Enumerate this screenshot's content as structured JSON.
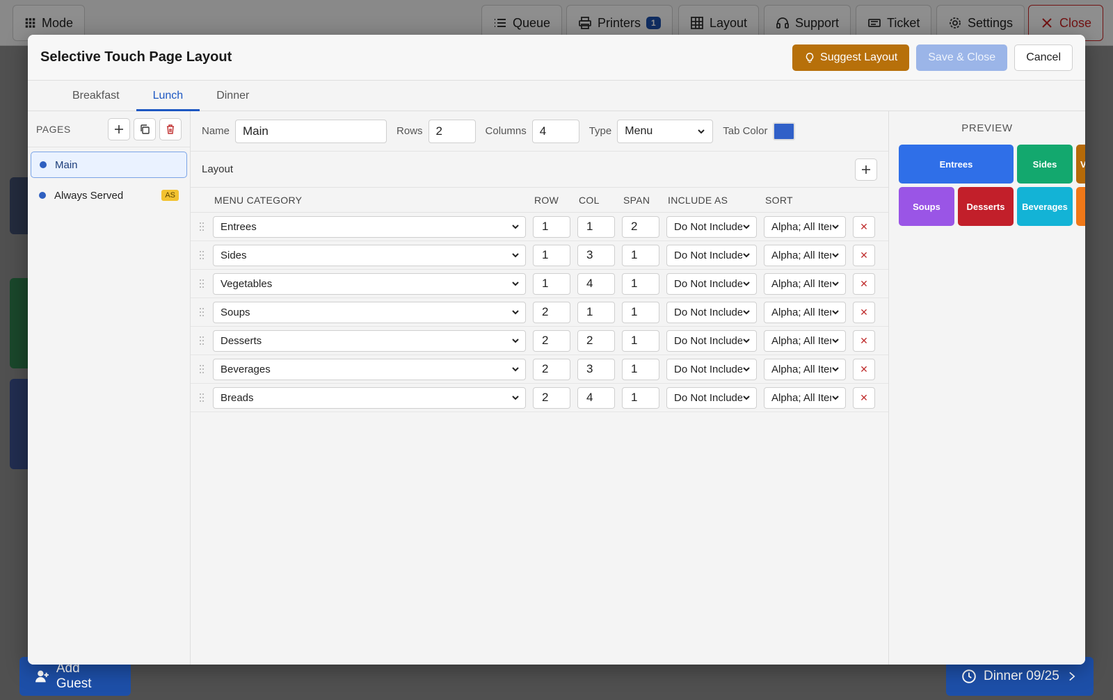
{
  "background": {
    "mode_label": "Mode",
    "toolbar": [
      {
        "label": "Queue"
      },
      {
        "label": "Printers",
        "badge": "1"
      },
      {
        "label": "Layout"
      },
      {
        "label": "Support"
      },
      {
        "label": "Ticket"
      },
      {
        "label": "Settings"
      },
      {
        "label": "Close"
      }
    ],
    "add_guest": "Add Guest",
    "meal_period": "Dinner 09/25"
  },
  "modal": {
    "title": "Selective Touch Page Layout",
    "suggest_label": "Suggest Layout",
    "save_label": "Save & Close",
    "cancel_label": "Cancel",
    "tabs": [
      {
        "label": "Breakfast",
        "active": false
      },
      {
        "label": "Lunch",
        "active": true
      },
      {
        "label": "Dinner",
        "active": false
      }
    ],
    "pages": {
      "title": "PAGES",
      "items": [
        {
          "label": "Main",
          "selected": true
        },
        {
          "label": "Always Served",
          "badge": "AS"
        }
      ]
    },
    "props": {
      "name_label": "Name",
      "name_value": "Main",
      "rows_label": "Rows",
      "rows_value": "2",
      "columns_label": "Columns",
      "columns_value": "4",
      "type_label": "Type",
      "type_value": "Menu",
      "tab_color_label": "Tab Color",
      "tab_color": "#3060c8"
    },
    "layout": {
      "title": "Layout",
      "headers": {
        "category": "MENU CATEGORY",
        "row": "ROW",
        "col": "COL",
        "span": "SPAN",
        "include": "INCLUDE AS",
        "sort": "SORT"
      },
      "rows": [
        {
          "category": "Entrees",
          "row": "1",
          "col": "1",
          "span": "2",
          "include": "Do Not Include",
          "sort": "Alpha; All Items"
        },
        {
          "category": "Sides",
          "row": "1",
          "col": "3",
          "span": "1",
          "include": "Do Not Include",
          "sort": "Alpha; All Items"
        },
        {
          "category": "Vegetables",
          "row": "1",
          "col": "4",
          "span": "1",
          "include": "Do Not Include",
          "sort": "Alpha; All Items"
        },
        {
          "category": "Soups",
          "row": "2",
          "col": "1",
          "span": "1",
          "include": "Do Not Include",
          "sort": "Alpha; All Items"
        },
        {
          "category": "Desserts",
          "row": "2",
          "col": "2",
          "span": "1",
          "include": "Do Not Include",
          "sort": "Alpha; All Items"
        },
        {
          "category": "Beverages",
          "row": "2",
          "col": "3",
          "span": "1",
          "include": "Do Not Include",
          "sort": "Alpha; All Items"
        },
        {
          "category": "Breads",
          "row": "2",
          "col": "4",
          "span": "1",
          "include": "Do Not Include",
          "sort": "Alpha; All Items"
        }
      ]
    },
    "preview": {
      "title": "PREVIEW",
      "tiles": [
        {
          "label": "Entrees",
          "row": 1,
          "col": 1,
          "span": 2,
          "color": "#2f6fe8"
        },
        {
          "label": "Sides",
          "row": 1,
          "col": 3,
          "span": 1,
          "color": "#13a86e"
        },
        {
          "label": "Vegetables",
          "row": 1,
          "col": 4,
          "span": 1,
          "color": "#b66a08"
        },
        {
          "label": "Soups",
          "row": 2,
          "col": 1,
          "span": 1,
          "color": "#9a55e6"
        },
        {
          "label": "Desserts",
          "row": 2,
          "col": 2,
          "span": 1,
          "color": "#c21f2a"
        },
        {
          "label": "Beverages",
          "row": 2,
          "col": 3,
          "span": 1,
          "color": "#13b3d6"
        },
        {
          "label": "Breads",
          "row": 2,
          "col": 4,
          "span": 1,
          "color": "#f07818"
        }
      ]
    }
  }
}
